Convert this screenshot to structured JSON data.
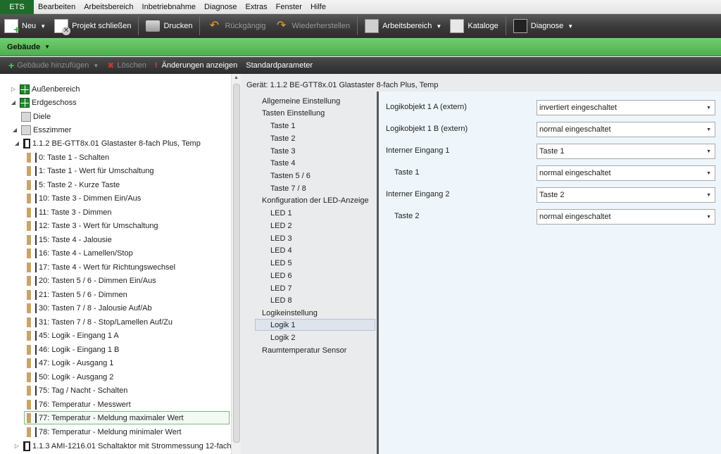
{
  "menu": {
    "app_tab": "ETS",
    "items": [
      "Bearbeiten",
      "Arbeitsbereich",
      "Inbetriebnahme",
      "Diagnose",
      "Extras",
      "Fenster",
      "Hilfe"
    ]
  },
  "toolbar": {
    "new": "Neu",
    "close_project": "Projekt schließen",
    "print": "Drucken",
    "undo": "Rückgängig",
    "redo": "Wiederherstellen",
    "workspace": "Arbeitsbereich",
    "catalogs": "Kataloge",
    "diagnose": "Diagnose"
  },
  "panel": {
    "title": "Gebäude"
  },
  "toolbar2": {
    "add_building": "Gebäude hinzufügen",
    "delete": "Löschen",
    "show_changes": "Änderungen anzeigen",
    "default_params": "Standardparameter"
  },
  "tree": {
    "nodes": [
      {
        "label": "Außenbereich",
        "icon": "grid"
      },
      {
        "label": "Erdgeschoss",
        "icon": "grid"
      },
      {
        "label": "Diele",
        "icon": "room"
      },
      {
        "label": "Esszimmer",
        "icon": "room"
      },
      {
        "label": "1.1.2  BE-GTT8x.01 Glastaster 8-fach Plus, Temp",
        "icon": "device"
      },
      {
        "label": "0: Taste 1 - Schalten",
        "icon": "co"
      },
      {
        "label": "1: Taste 1 - Wert für Umschaltung",
        "icon": "co"
      },
      {
        "label": "5: Taste 2 - Kurze Taste",
        "icon": "co"
      },
      {
        "label": "10: Taste 3 - Dimmen Ein/Aus",
        "icon": "co"
      },
      {
        "label": "11: Taste 3 - Dimmen",
        "icon": "co"
      },
      {
        "label": "12: Taste 3 - Wert für Umschaltung",
        "icon": "co"
      },
      {
        "label": "15: Taste 4 - Jalousie",
        "icon": "co"
      },
      {
        "label": "16: Taste 4 - Lamellen/Stop",
        "icon": "co"
      },
      {
        "label": "17: Taste 4 - Wert für Richtungswechsel",
        "icon": "co"
      },
      {
        "label": "20: Tasten 5 / 6 - Dimmen Ein/Aus",
        "icon": "co"
      },
      {
        "label": "21: Tasten 5 / 6 - Dimmen",
        "icon": "co"
      },
      {
        "label": "30: Tasten 7 / 8 - Jalousie Auf/Ab",
        "icon": "co"
      },
      {
        "label": "31: Tasten 7 / 8 - Stop/Lamellen Auf/Zu",
        "icon": "co"
      },
      {
        "label": "45: Logik - Eingang 1 A",
        "icon": "co"
      },
      {
        "label": "46: Logik - Eingang 1 B",
        "icon": "co"
      },
      {
        "label": "47: Logik - Ausgang 1",
        "icon": "co"
      },
      {
        "label": "50: Logik - Ausgang 2",
        "icon": "co"
      },
      {
        "label": "75: Tag / Nacht - Schalten",
        "icon": "co"
      },
      {
        "label": "76: Temperatur - Messwert",
        "icon": "co"
      },
      {
        "label": "77: Temperatur - Meldung maximaler Wert",
        "icon": "co"
      },
      {
        "label": "78: Temperatur - Meldung minimaler Wert",
        "icon": "co"
      },
      {
        "label": "1.1.3  AMI-1216.01 Schaltaktor mit Strommessung 12-fach",
        "icon": "device"
      }
    ]
  },
  "device_header": "Gerät: 1.1.2  BE-GTT8x.01 Glastaster 8-fach Plus, Temp",
  "param_nav": [
    "Allgemeine Einstellung",
    "Tasten Einstellung",
    "Taste 1",
    "Taste 2",
    "Taste 3",
    "Taste 4",
    "Tasten 5 / 6",
    "Taste 7 / 8",
    "Konfiguration der LED-Anzeige",
    "LED 1",
    "LED 2",
    "LED 3",
    "LED 4",
    "LED 5",
    "LED 6",
    "LED 7",
    "LED 8",
    "Logikeinstellung",
    "Logik 1",
    "Logik 2",
    "Raumtemperatur Sensor"
  ],
  "params": [
    {
      "label": "Logikobjekt 1 A (extern)",
      "value": "invertiert eingeschaltet"
    },
    {
      "label": "Logikobjekt 1 B (extern)",
      "value": "normal eingeschaltet"
    },
    {
      "label": "Interner Eingang 1",
      "value": "Taste 1"
    },
    {
      "label": "Taste 1",
      "value": "normal eingeschaltet"
    },
    {
      "label": "Interner Eingang 2",
      "value": "Taste 2"
    },
    {
      "label": "Taste 2",
      "value": "normal eingeschaltet"
    }
  ]
}
